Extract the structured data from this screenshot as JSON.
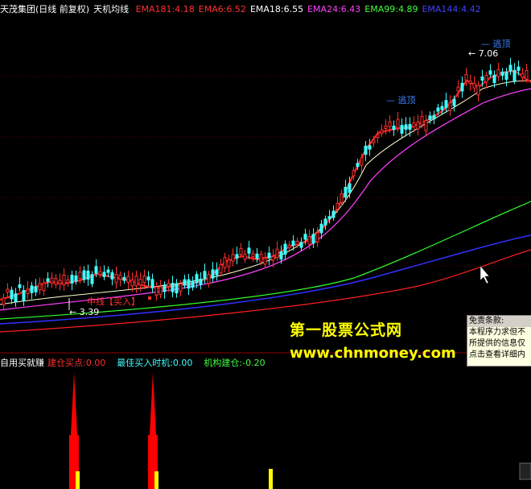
{
  "header": {
    "stock_name": "天茂集团(日线 前复权)",
    "indicator_name": "天机均线",
    "ema_items": [
      {
        "label": "EMA181:4.18",
        "color": "#ff3030"
      },
      {
        "label": "EMA6:6.52",
        "color": "#ff3030"
      },
      {
        "label": "EMA18:6.55",
        "color": "#ffffff"
      },
      {
        "label": "EMA24:6.43",
        "color": "#ff40ff"
      },
      {
        "label": "EMA99:4.89",
        "color": "#40ff40"
      },
      {
        "label": "EMA144:4.42",
        "color": "#4040ff"
      }
    ]
  },
  "annotations": {
    "mid_buy": "中线【买入】",
    "low_price": "3.39",
    "high_price": "7.06",
    "escape_top_1": "逃顶",
    "escape_top_2": "逃顶"
  },
  "indicator_panel": {
    "name": "自用买就赚",
    "items": [
      {
        "label": "建仓买点:0.00",
        "color": "#ff3030"
      },
      {
        "label": "最佳买入时机:0.00",
        "color": "#40ffff"
      },
      {
        "label": "机构建仓:-0.20",
        "color": "#40ff40"
      }
    ]
  },
  "watermark": {
    "title": "第一股票公式网",
    "url": "www.chnmoney.com"
  },
  "disclaimer": {
    "title": "免责条款:",
    "lines": [
      "本程序力求但不",
      "所提供的信息仅",
      "点击查看详细内"
    ]
  },
  "colors": {
    "background": "#000000",
    "up_candle": "#ff3030",
    "down_candle": "#40ffff",
    "buy_bar_red": "#ff0000",
    "buy_bar_yellow": "#ffff00"
  }
}
